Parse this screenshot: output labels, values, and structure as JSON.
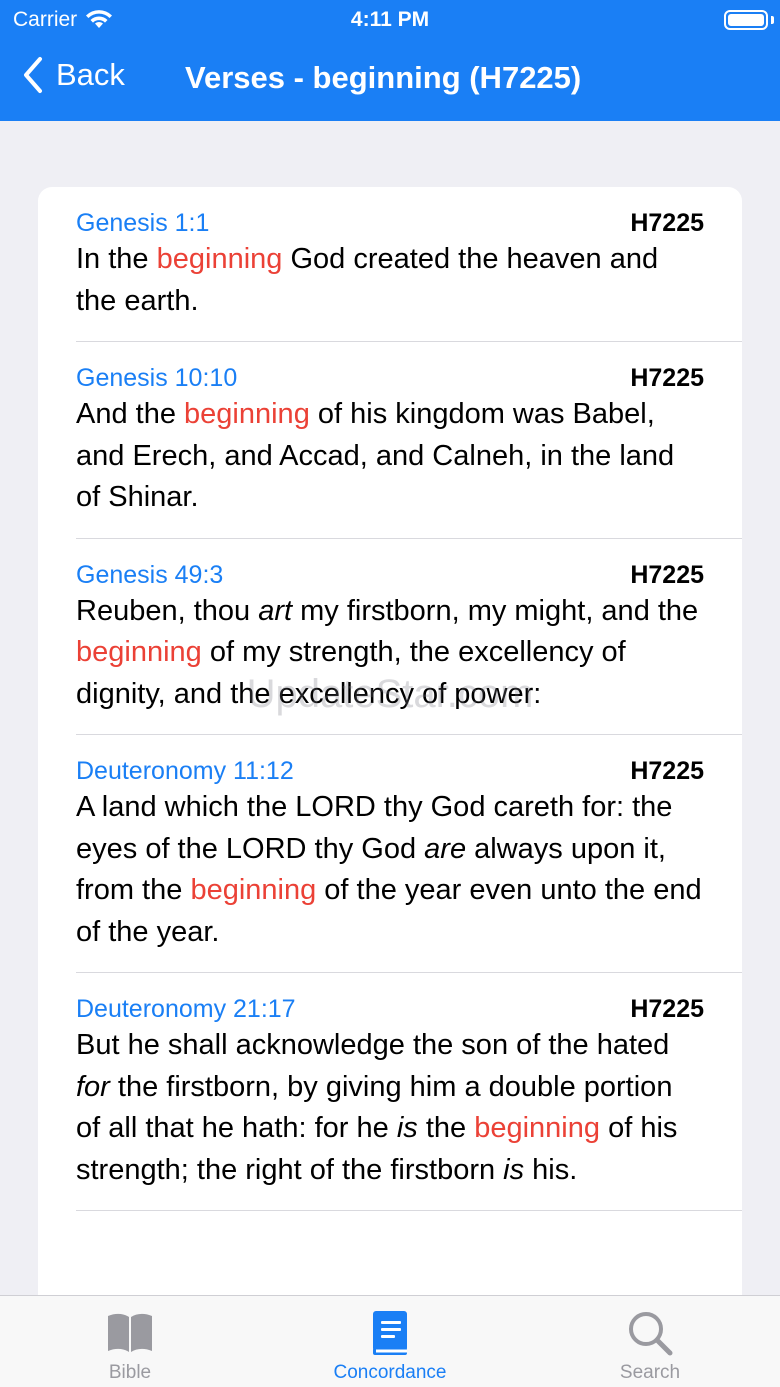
{
  "status_bar": {
    "carrier": "Carrier",
    "time": "4:11 PM"
  },
  "nav": {
    "back_label": "Back",
    "title": "Verses - beginning (H7225)"
  },
  "verses": [
    {
      "reference": "Genesis 1:1",
      "code": "H7225",
      "segments": [
        {
          "text": "In the "
        },
        {
          "text": "beginning",
          "style": "highlight"
        },
        {
          "text": " God created the heaven and the earth."
        }
      ]
    },
    {
      "reference": "Genesis 10:10",
      "code": "H7225",
      "segments": [
        {
          "text": "And the "
        },
        {
          "text": "beginning",
          "style": "highlight"
        },
        {
          "text": " of his kingdom was Babel, and Erech, and Accad, and Calneh, in the land of Shinar."
        }
      ]
    },
    {
      "reference": "Genesis 49:3",
      "code": "H7225",
      "segments": [
        {
          "text": "Reuben, thou "
        },
        {
          "text": "art",
          "style": "italic"
        },
        {
          "text": " my firstborn, my might, and the "
        },
        {
          "text": "beginning",
          "style": "highlight"
        },
        {
          "text": " of my strength, the excellency of dignity, and the excellency of power:"
        }
      ]
    },
    {
      "reference": "Deuteronomy 11:12",
      "code": "H7225",
      "segments": [
        {
          "text": "A land which the LORD thy God careth for: the eyes of the LORD thy God "
        },
        {
          "text": "are",
          "style": "italic"
        },
        {
          "text": " always upon it, from the "
        },
        {
          "text": "beginning",
          "style": "highlight"
        },
        {
          "text": " of the year even unto the end of the year."
        }
      ]
    },
    {
      "reference": "Deuteronomy 21:17",
      "code": "H7225",
      "segments": [
        {
          "text": "But he shall acknowledge the son of the hated "
        },
        {
          "text": "for",
          "style": "italic"
        },
        {
          "text": " the firstborn, by giving him a double portion of all that he hath: for he "
        },
        {
          "text": "is",
          "style": "italic"
        },
        {
          "text": " the "
        },
        {
          "text": "beginning",
          "style": "highlight"
        },
        {
          "text": " of his strength; the right of the firstborn "
        },
        {
          "text": "is",
          "style": "italic"
        },
        {
          "text": " his."
        }
      ]
    }
  ],
  "watermark": "UpdateStar.com",
  "tabs": [
    {
      "label": "Bible",
      "icon": "book-open-icon",
      "active": false
    },
    {
      "label": "Concordance",
      "icon": "book-closed-icon",
      "active": true
    },
    {
      "label": "Search",
      "icon": "magnifier-icon",
      "active": false
    }
  ],
  "colors": {
    "accent": "#1a7ff5",
    "highlight": "#eb4136",
    "background": "#efeff4"
  }
}
